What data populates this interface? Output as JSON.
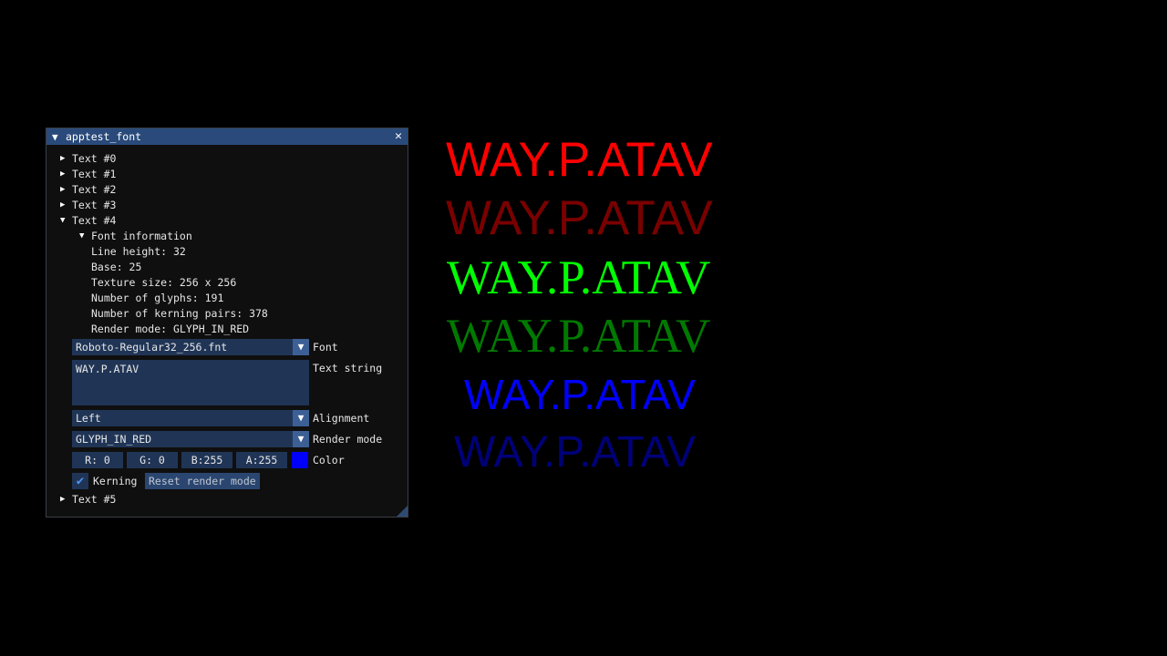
{
  "window": {
    "title": "apptest_font",
    "collapse_icon": "triangle-down-icon",
    "close_icon": "close-icon"
  },
  "tree": {
    "text0": "Text #0",
    "text1": "Text #1",
    "text2": "Text #2",
    "text3": "Text #3",
    "text4": "Text #4",
    "text5": "Text #5"
  },
  "font_info": {
    "header": "Font information",
    "line_height": "Line height: 32",
    "base": "Base: 25",
    "texture_size": "Texture size: 256 x 256",
    "glyphs": "Number of glyphs: 191",
    "kerning_pairs": "Number of kerning pairs: 378",
    "render_mode": "Render mode: GLYPH_IN_RED"
  },
  "controls": {
    "font_value": "Roboto-Regular32_256.fnt",
    "font_label": "Font",
    "text_value": "WAY.P.ATAV",
    "text_label": "Text string",
    "alignment_value": "Left",
    "alignment_label": "Alignment",
    "render_mode_value": "GLYPH_IN_RED",
    "render_mode_label": "Render mode",
    "color_r": "R:  0",
    "color_g": "G:  0",
    "color_b": "B:255",
    "color_a": "A:255",
    "color_label": "Color",
    "color_value": "#0000ff",
    "kerning_label": "Kerning",
    "kerning_checked": true,
    "reset_button": "Reset render mode"
  },
  "samples": {
    "text": "WAY.P.ATAV",
    "colors": [
      "#ff0000",
      "#7a0000",
      "#00ff00",
      "#007a00",
      "#0000ff",
      "#00007a"
    ]
  }
}
